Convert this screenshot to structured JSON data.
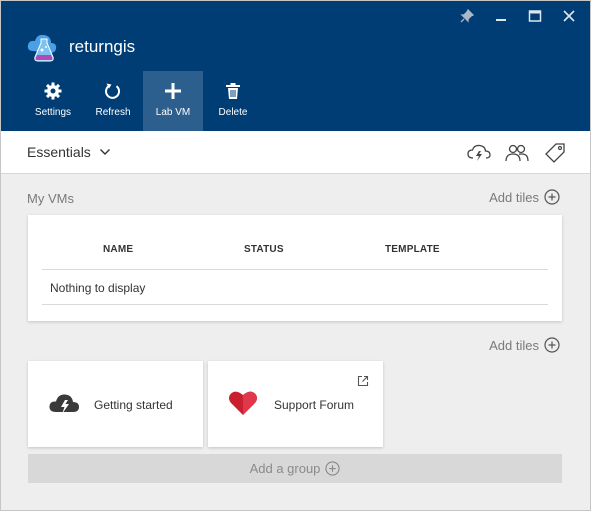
{
  "window": {
    "title": "returngis",
    "controls": [
      "pin-icon",
      "minimize-icon",
      "maximize-icon",
      "close-icon"
    ]
  },
  "commands": [
    {
      "label": "Settings",
      "icon": "gear-icon"
    },
    {
      "label": "Refresh",
      "icon": "refresh-icon"
    },
    {
      "label": "Lab VM",
      "icon": "plus-icon",
      "active": true
    },
    {
      "label": "Delete",
      "icon": "trash-icon"
    }
  ],
  "essentials": {
    "label": "Essentials",
    "icons": [
      "cloud-lightning-icon",
      "users-icon",
      "tag-icon"
    ]
  },
  "my_vms": {
    "title": "My VMs",
    "add_tiles": "Add tiles",
    "columns": [
      "NAME",
      "STATUS",
      "TEMPLATE"
    ],
    "empty_text": "Nothing to display"
  },
  "tiles_section": {
    "add_tiles": "Add tiles",
    "tiles": [
      {
        "label": "Getting started",
        "icon": "cloud-lightning-icon"
      },
      {
        "label": "Support Forum",
        "icon": "heart-icon",
        "external": true
      }
    ]
  },
  "add_group": "Add a group",
  "colors": {
    "header_bg": "#003d74",
    "active_command_bg": "#2c5f8e",
    "body_bg": "#eeeeee",
    "heart": "#c8202f"
  }
}
